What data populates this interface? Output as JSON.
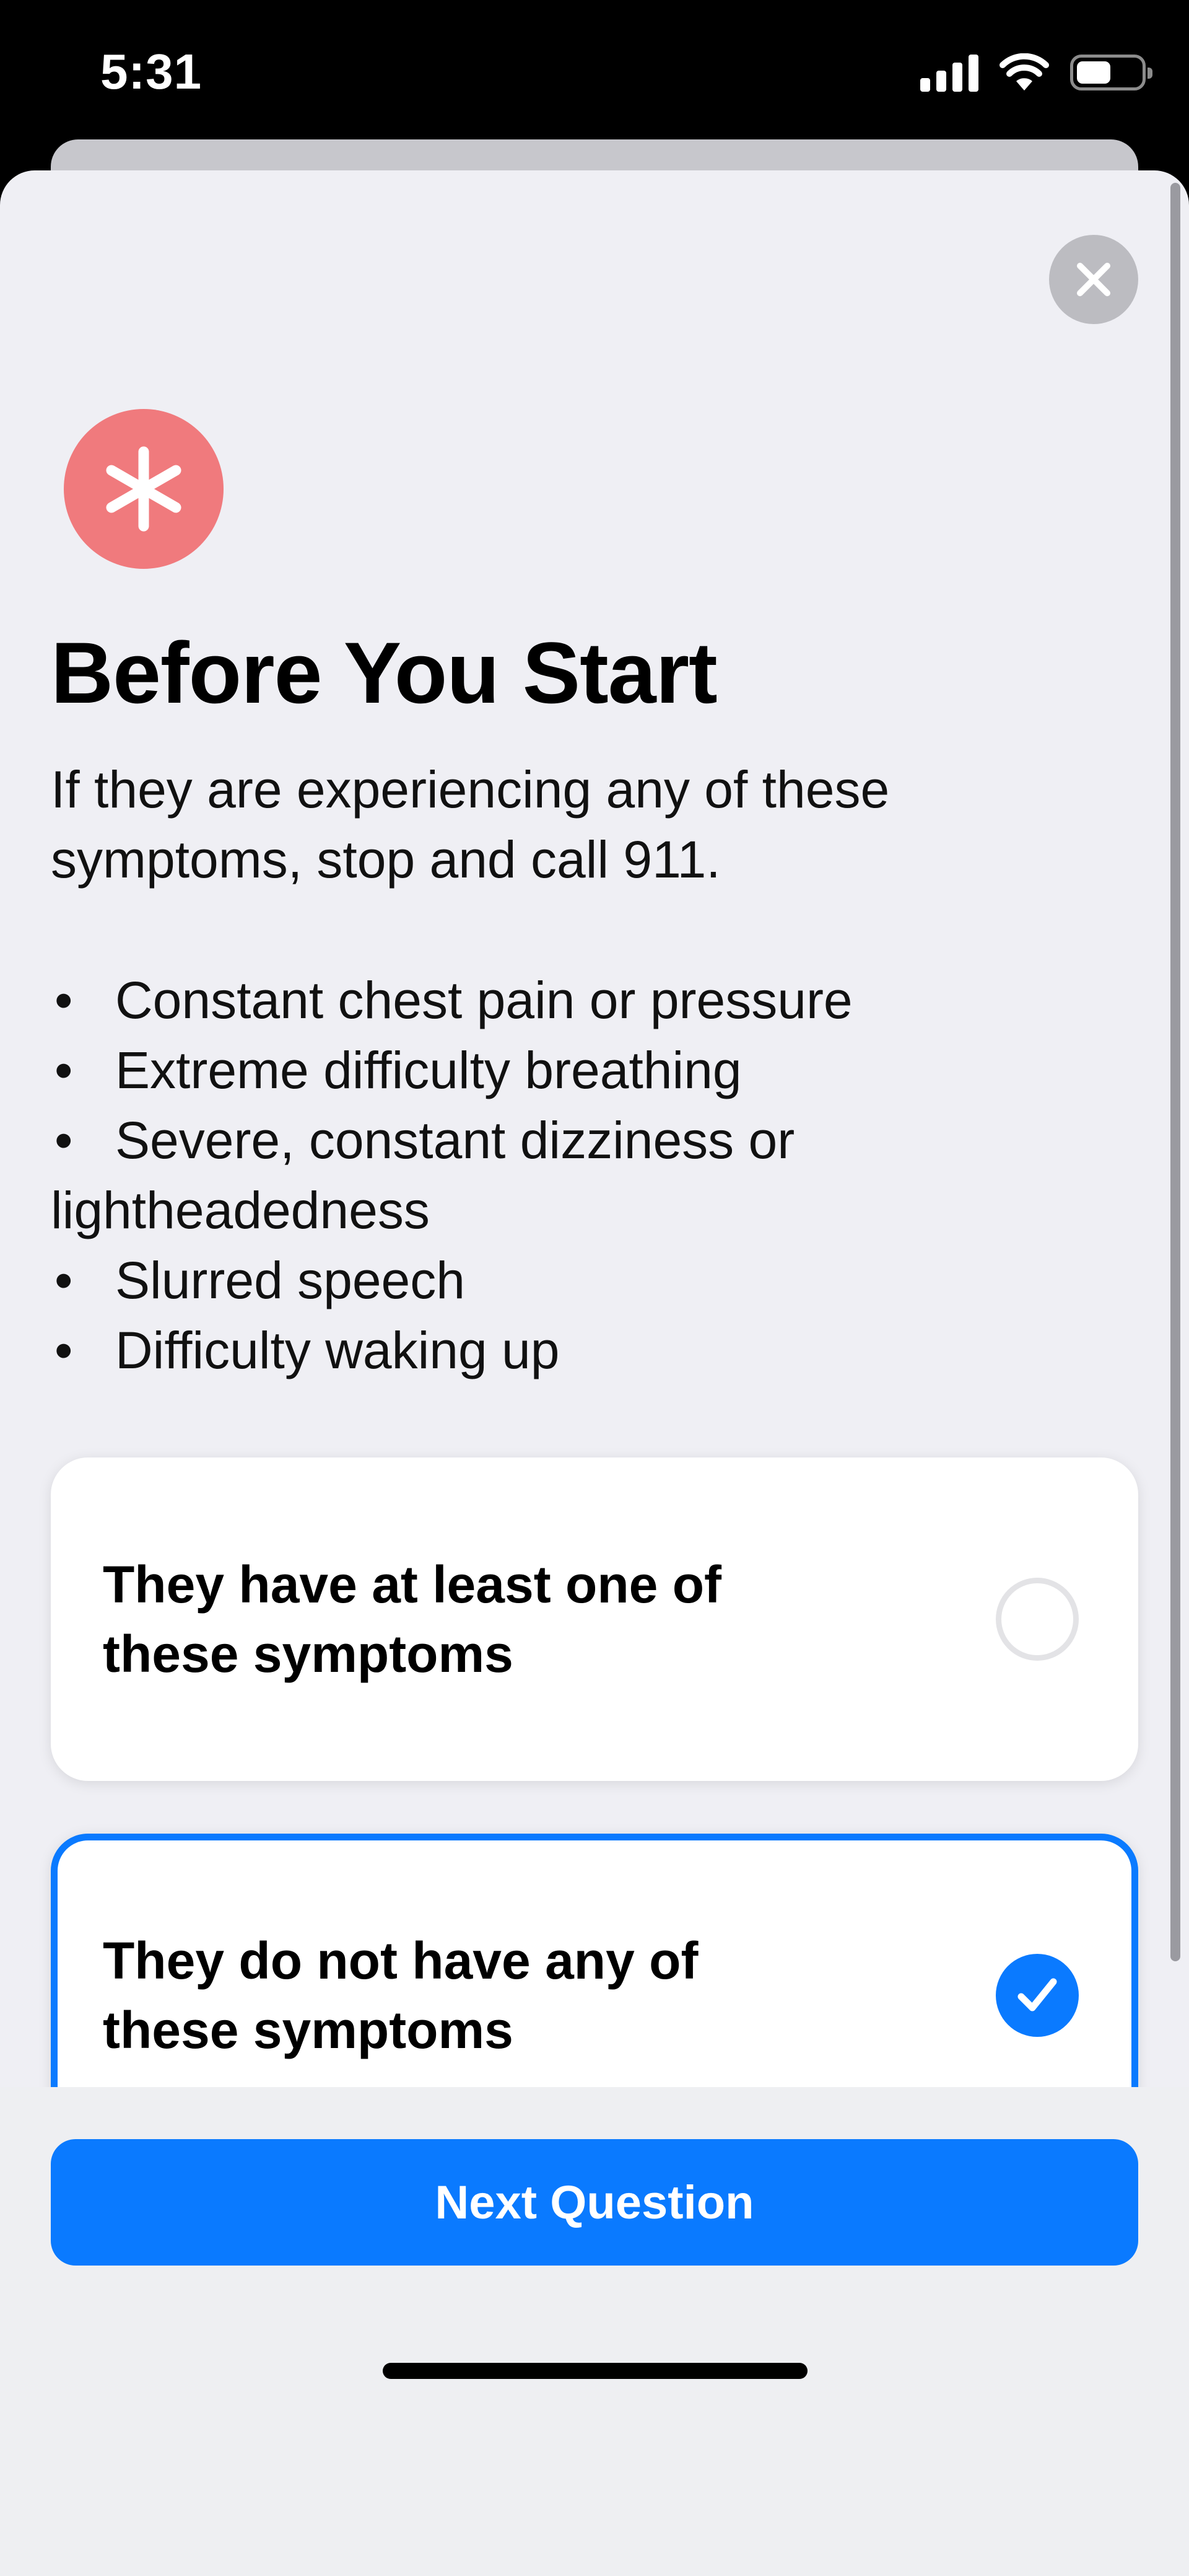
{
  "status_bar": {
    "time": "5:31"
  },
  "icons": {
    "signal": "cellular-signal-icon",
    "wifi": "wifi-icon",
    "battery": "battery-icon",
    "close": "close-icon",
    "medical": "asterisk-medical-icon",
    "check": "checkmark-icon"
  },
  "colors": {
    "accent": "#0a7aff",
    "badge": "#f07a7d",
    "sheet_background": "#efeff4"
  },
  "header": {
    "title": "Before You Start",
    "intro": "If they are experiencing any of these symptoms, stop and call 911."
  },
  "symptoms": [
    {
      "bullet": "•",
      "text": "Constant chest pain or pressure"
    },
    {
      "bullet": "•",
      "text": "Extreme difficulty breathing"
    },
    {
      "bullet": "•",
      "text": "Severe, constant dizziness or lightheadedness"
    },
    {
      "bullet": "•",
      "text": "Slurred speech"
    },
    {
      "bullet": "•",
      "text": "Difficulty waking up"
    }
  ],
  "options": [
    {
      "label": "They have at least one of these symptoms",
      "selected": false
    },
    {
      "label": "They do not have any of these symptoms",
      "selected": true
    }
  ],
  "footer": {
    "next_label": "Next Question"
  }
}
